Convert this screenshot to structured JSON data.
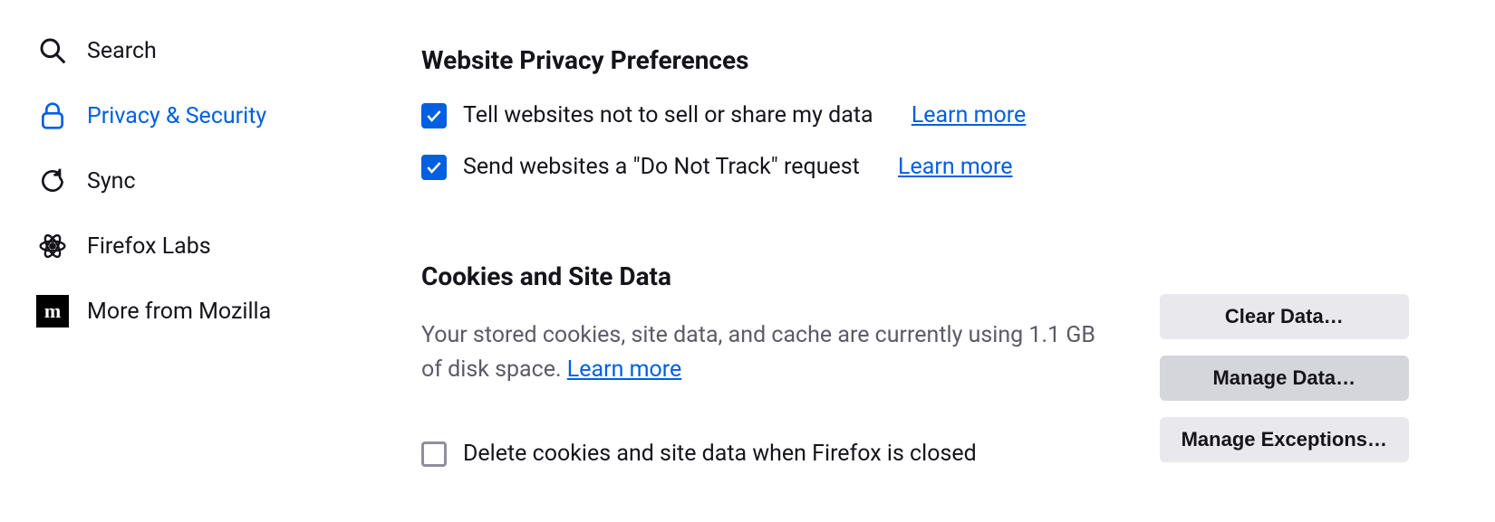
{
  "sidebar": {
    "items": [
      {
        "label": "Search"
      },
      {
        "label": "Privacy & Security"
      },
      {
        "label": "Sync"
      },
      {
        "label": "Firefox Labs"
      },
      {
        "label": "More from Mozilla"
      }
    ]
  },
  "privacy": {
    "title": "Website Privacy Preferences",
    "opt1_label": "Tell websites not to sell or share my data",
    "opt1_link": "Learn more",
    "opt2_label": "Send websites a \"Do Not Track\" request",
    "opt2_link": "Learn more"
  },
  "cookies": {
    "title": "Cookies and Site Data",
    "desc_prefix": "Your stored cookies, site data, and cache are currently using ",
    "desc_size": "1.1 GB",
    "desc_suffix": " of disk space. ",
    "desc_link": "Learn more",
    "delete_label": "Delete cookies and site data when Firefox is closed",
    "clear_btn": "Clear Data…",
    "manage_btn": "Manage Data…",
    "exceptions_btn": "Manage Exceptions…"
  }
}
